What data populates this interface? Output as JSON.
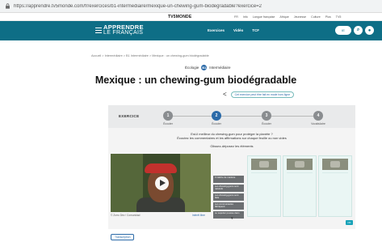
{
  "browser": {
    "url": "https://apprendre.tv5monde.com/fr/exercices/b1-intermediaire/mexique-un-chewing-gum-biodegradable?exercice=2"
  },
  "top_strip": {
    "brand": "TV5MONDE",
    "links": [
      "FR",
      "Info",
      "Langue française",
      "Afrique",
      "Jeunesse",
      "Culture",
      "Plus",
      "TV5"
    ]
  },
  "header": {
    "logo_line1": "APPRENDRE",
    "logo_line2": "LE FRANÇAIS",
    "nav": [
      "Exercices",
      "Vidéo",
      "TCF"
    ],
    "toggle_label": "IE",
    "icons": [
      "search-icon",
      "user-icon"
    ],
    "bg_color": "#0e6e86"
  },
  "breadcrumb": "Accueil > Intermédiaire > B1 Intermédiaire > Mexique : un chewing-gum biodégradable",
  "level": {
    "label": "Écologie",
    "badge": "B1",
    "name": "Intermédiaire"
  },
  "page_title": "Mexique : un chewing-gum biodégradable",
  "share_icon": "share-icon",
  "notice": "Cet exercice peut être fait en mode hors ligne",
  "exercise": {
    "label": "EXERCICE",
    "steps": [
      {
        "num": "1",
        "label": "Écouter"
      },
      {
        "num": "2",
        "label": "Écouter"
      },
      {
        "num": "3",
        "label": "Écouter"
      },
      {
        "num": "4",
        "label": "Vocabulaire"
      }
    ],
    "active_step": 2,
    "instruction1": "Est-il meilleur du chewing-gum pour protéger la planète ?",
    "instruction2": "Écoutez les commentaires et les affirmations sur chaque feuille ou non vides",
    "instruction3": "Glissez-déposez les éléments",
    "video_caption": "© Zorro Dév / Comunidad",
    "video_link": "Intérêt libre",
    "items": [
      "Il mâche de manière",
      "Les chewing-gums sont naturels",
      "Les chewing-gums sont faits",
      "Les communautés fabriquent",
      "Le sapotier pousse dans"
    ],
    "validate_label": "OK"
  },
  "transcript_button": "Transcription"
}
